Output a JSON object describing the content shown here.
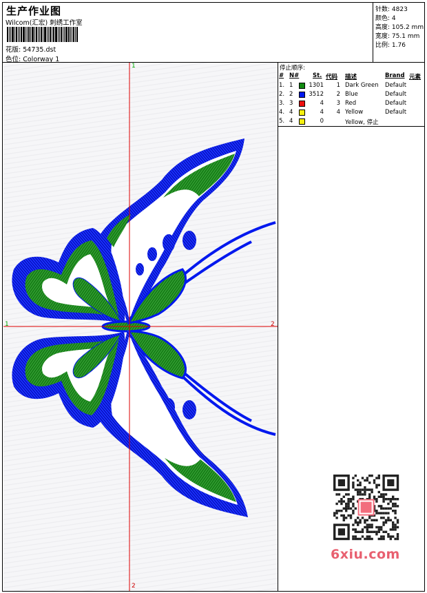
{
  "header": {
    "title": "生产作业图",
    "company": "Wilcom(汇宏) 刺绣工作室",
    "design_label": "花版:",
    "design_file": "54735.dst",
    "color_label": "色位:",
    "colorway": "Colorway 1"
  },
  "stats": [
    {
      "label": "针数:",
      "value": "4823"
    },
    {
      "label": "颜色:",
      "value": "4"
    },
    {
      "label": "高度:",
      "value": "105.2 mm"
    },
    {
      "label": "宽度:",
      "value": "75.1 mm"
    },
    {
      "label": "比例:",
      "value": "1.76"
    }
  ],
  "axes": {
    "top": "1",
    "left": "1",
    "right": "2",
    "bottom": "2"
  },
  "sequence": {
    "caption": "停止顺序:",
    "headers": [
      "#",
      "N#",
      "St.",
      "代码",
      "描述",
      "Brand",
      "元素"
    ],
    "rows": [
      {
        "idx": "1.",
        "n": "1",
        "st": "1301",
        "code": "1",
        "desc": "Dark Green",
        "brand": "Default",
        "color": "#118a11"
      },
      {
        "idx": "2.",
        "n": "2",
        "st": "3512",
        "code": "2",
        "desc": "Blue",
        "brand": "Default",
        "color": "#0018ee"
      },
      {
        "idx": "3.",
        "n": "3",
        "st": "4",
        "code": "3",
        "desc": "Red",
        "brand": "Default",
        "color": "#ee1010"
      },
      {
        "idx": "4.",
        "n": "4",
        "st": "4",
        "code": "4",
        "desc": "Yellow",
        "brand": "Default",
        "color": "#f5ef10"
      },
      {
        "idx": "5.",
        "n": "4",
        "st": "0",
        "code": "",
        "desc": "Yellow, 停止",
        "brand": "",
        "color": "#f5ef10"
      }
    ]
  },
  "watermark": {
    "brand": "6xiu.com",
    "seal": "刺绣图库"
  },
  "colors": {
    "green": "#118a11",
    "blue": "#0018ee",
    "axis": "#dd0000"
  }
}
